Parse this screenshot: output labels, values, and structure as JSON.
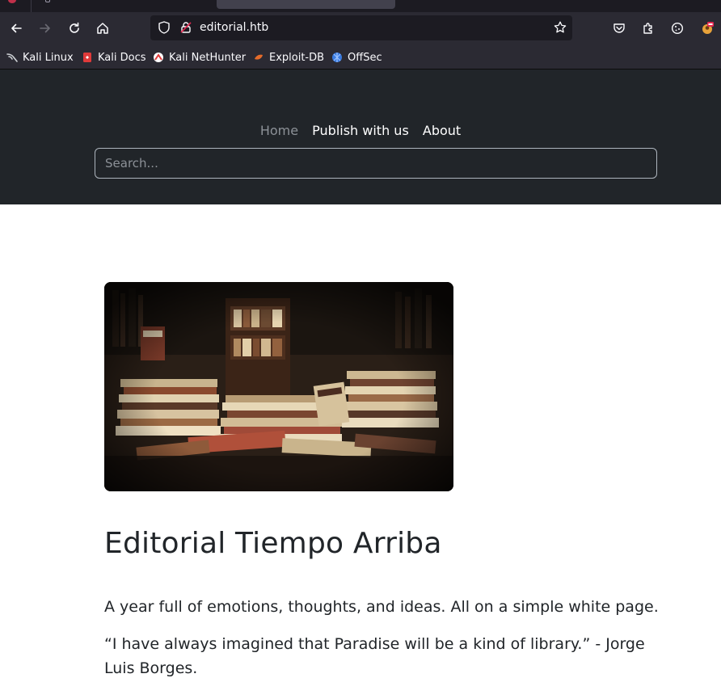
{
  "browser": {
    "url": "editorial.htb",
    "icons": [
      "back-icon",
      "forward-icon",
      "reload-icon",
      "home-icon",
      "shield-icon",
      "lock-icon",
      "bookmark-star-icon",
      "pocket-icon",
      "extensions-icon",
      "cookie-icon",
      "profile-icon"
    ],
    "bookmarks": [
      {
        "label": "Kali Linux",
        "icon": "kali-icon",
        "color": "#cfd2d6"
      },
      {
        "label": "Kali Docs",
        "icon": "kali-docs-icon",
        "color": "#e03a3a"
      },
      {
        "label": "Kali NetHunter",
        "icon": "nethunter-icon",
        "color": "#e03a3a"
      },
      {
        "label": "Exploit-DB",
        "icon": "exploit-db-icon",
        "color": "#e56b2a"
      },
      {
        "label": "OffSec",
        "icon": "offsec-icon",
        "color": "#3a7be0"
      }
    ]
  },
  "site": {
    "nav": {
      "home": "Home",
      "publish": "Publish with us",
      "about": "About"
    },
    "search": {
      "placeholder": "Search..."
    },
    "colors": {
      "header_bg": "#212529",
      "nav_active": "#8c9197",
      "text": "#212529"
    }
  },
  "article": {
    "title": "Editorial Tiempo Arriba",
    "lead": "A year full of emotions, thoughts, and ideas. All on a simple white page.",
    "quote": "“I have always imagined that Paradise will be a kind of library.” - Jorge Luis Borges."
  }
}
